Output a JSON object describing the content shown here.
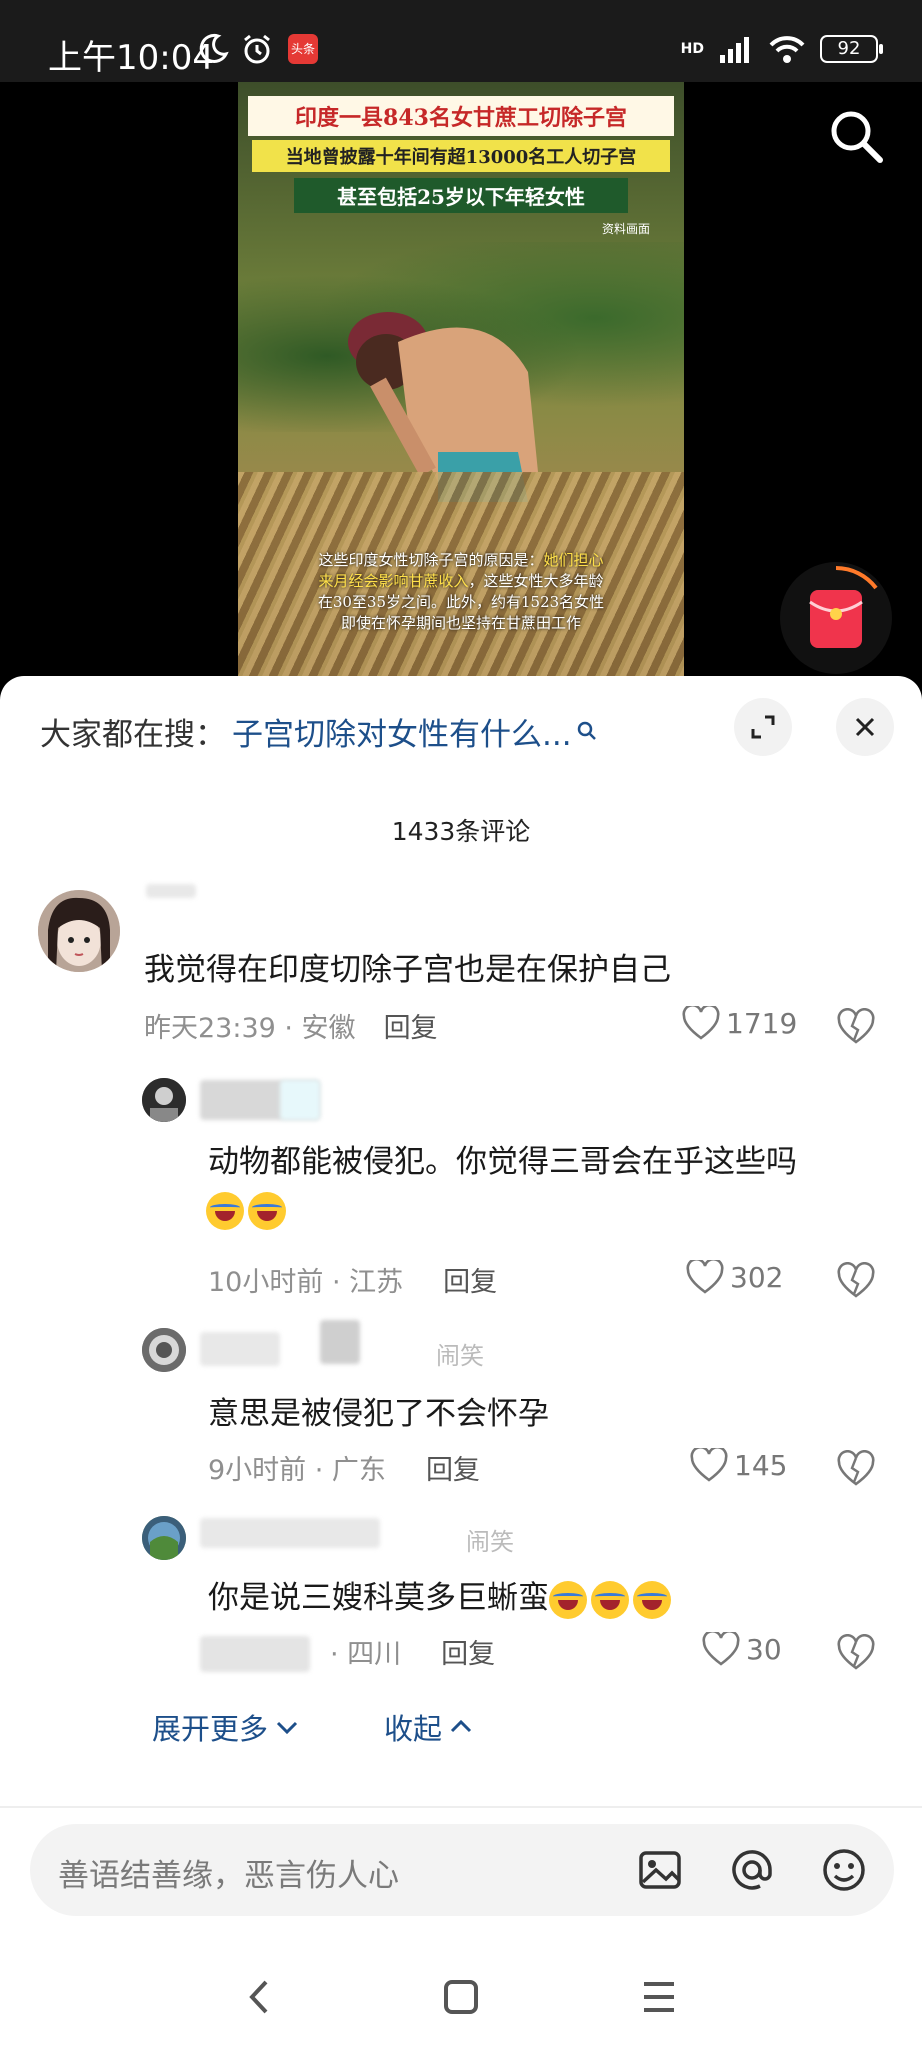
{
  "status_bar": {
    "time": "上午10:04",
    "app_badge": "头条",
    "network": "HD",
    "battery": "92"
  },
  "video": {
    "title": "印度一县843名女甘蔗工切除子宫",
    "subtitle1": "当地曾披露十年间有超13000名工人切子宫",
    "subtitle2": "甚至包括25岁以下年轻女性",
    "source": "资料画面",
    "caption_line1_a": "这些印度女性切除子宫的原因是：",
    "caption_line1_b": "她们担心",
    "caption_line2_a": "来月经会影响甘蔗收入",
    "caption_line2_b": "，这些女性大多年龄",
    "caption_line3": "在30至35岁之间。此外，约有1523名女性",
    "caption_line4": "即使在怀孕期间也坚持在甘蔗田工作"
  },
  "search": {
    "label": "大家都在搜：",
    "query": "子宫切除对女性有什么..."
  },
  "comments_header": {
    "count": "1433条评论"
  },
  "comments": [
    {
      "text": "我觉得在印度切除子宫也是在保护自己",
      "time": "昨天23:39 · 安徽",
      "reply": "回复",
      "likes": "1719"
    },
    {
      "text": "动物都能被侵犯。你觉得三哥会在乎这些吗",
      "time": "10小时前 · 江苏",
      "reply": "回复",
      "likes": "302"
    },
    {
      "tag": "闹笑",
      "text": "意思是被侵犯了不会怀孕",
      "time": "9小时前 · 广东",
      "reply": "回复",
      "likes": "145"
    },
    {
      "tag": "闹笑",
      "text": "你是说三嫂科莫多巨蜥蛮",
      "time": "· 四川",
      "reply": "回复",
      "likes": "30"
    }
  ],
  "actions": {
    "expand_more": "展开更多",
    "collapse": "收起"
  },
  "input": {
    "placeholder": "善语结善缘，恶言伤人心"
  },
  "colors": {
    "link_blue": "#1d4f8a",
    "meta_gray": "#8f8f8f",
    "title_red": "#c62828"
  }
}
